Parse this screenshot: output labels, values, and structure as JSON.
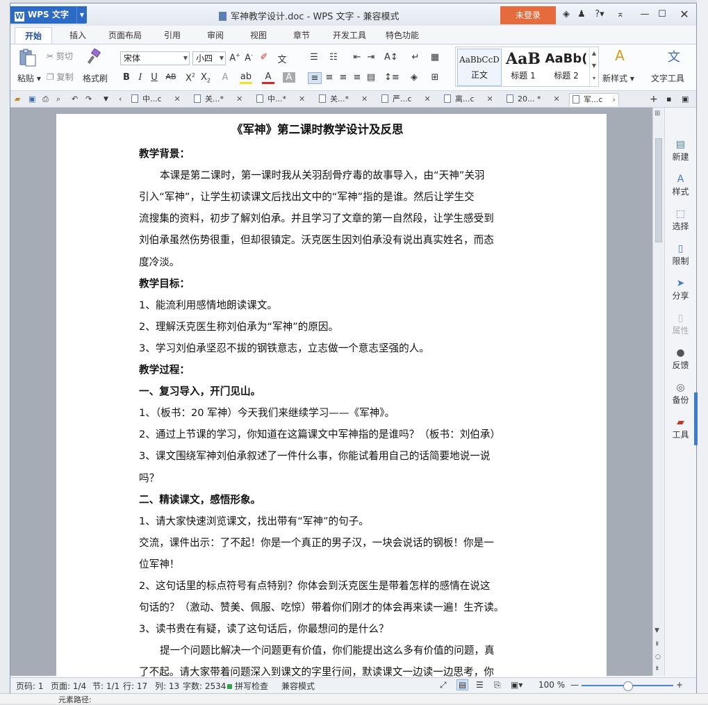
{
  "window": {
    "app_name": "WPS 文字",
    "title": "军神教学设计.doc - WPS 文字 - 兼容模式",
    "login_button": "未登录",
    "controls": [
      "help-?",
      "minimize",
      "maximize",
      "close"
    ]
  },
  "ribbon": {
    "tabs": [
      "开始",
      "插入",
      "页面布局",
      "引用",
      "审阅",
      "视图",
      "章节",
      "开发工具",
      "特色功能"
    ],
    "active_tab": "开始",
    "clipboard": {
      "paste": "粘贴",
      "cut": "剪切",
      "copy": "复制",
      "format_painter": "格式刷"
    },
    "font_name": "宋体",
    "font_size": "小四",
    "styles": [
      {
        "preview": "AaBbCcD",
        "label": "正文"
      },
      {
        "preview": "AaB",
        "label": "标题 1"
      },
      {
        "preview": "AaBb(",
        "label": "标题 2"
      }
    ],
    "new_style": "新样式",
    "text_tools": "文字工具"
  },
  "doc_tabs": [
    {
      "label": "中...c",
      "active": false
    },
    {
      "label": "关...*",
      "active": false
    },
    {
      "label": "中...*",
      "active": false
    },
    {
      "label": "关...*",
      "active": false
    },
    {
      "label": "严...c",
      "active": false
    },
    {
      "label": "离...c",
      "active": false
    },
    {
      "label": "20... *",
      "active": false
    },
    {
      "label": "军...c",
      "active": true
    }
  ],
  "sidebar": [
    {
      "label": "新建",
      "icon": "new-doc-icon"
    },
    {
      "label": "样式",
      "icon": "style-icon"
    },
    {
      "label": "选择",
      "icon": "select-icon"
    },
    {
      "label": "限制",
      "icon": "restrict-icon"
    },
    {
      "label": "分享",
      "icon": "share-icon"
    },
    {
      "label": "属性",
      "icon": "properties-icon"
    },
    {
      "label": "反馈",
      "icon": "feedback-icon"
    },
    {
      "label": "备份",
      "icon": "backup-icon"
    },
    {
      "label": "工具",
      "icon": "toolbox-icon"
    }
  ],
  "document": {
    "title": "《军神》第二课时教学设计及反思",
    "lines": [
      {
        "text": "教学背景：",
        "bold": true
      },
      {
        "text": "本课是第二课时，第一课时我从关羽刮骨疗毒的故事导入，由“天神”关羽",
        "indent": true
      },
      {
        "text": "引入“军神”，让学生初读课文后找出文中的“军神”指的是谁。然后让学生交"
      },
      {
        "text": "流搜集的资料，初步了解刘伯承。并且学习了文章的第一自然段，让学生感受到"
      },
      {
        "text": "刘伯承虽然伤势很重，但却很镇定。沃克医生因刘伯承没有说出真实姓名，而态"
      },
      {
        "text": "度冷淡。"
      },
      {
        "text": "教学目标：",
        "bold": true
      },
      {
        "text": "1、能流利用感情地朗读课文。"
      },
      {
        "text": "2、理解沃克医生称刘伯承为“军神”的原因。"
      },
      {
        "text": "3、学习刘伯承坚忍不拔的钢铁意志，立志做一个意志坚强的人。"
      },
      {
        "text": "教学过程：",
        "bold": true
      },
      {
        "text": "一、复习导入，开门见山。",
        "bold": true
      },
      {
        "text": "1、（板书：20 军神）今天我们来继续学习——《军神》。"
      },
      {
        "text": "2、通过上节课的学习，你知道在这篇课文中军神指的是谁吗？（板书：刘伯承）"
      },
      {
        "text": "3、课文围绕军神刘伯承叙述了一件什么事，你能试着用自己的话简要地说一说"
      },
      {
        "text": "吗？"
      },
      {
        "text": "二、精读课文，感悟形象。",
        "bold": true
      },
      {
        "text": "1、请大家快速浏览课文，找出带有“军神”的句子。"
      },
      {
        "text": "交流，课件出示：了不起！你是一个真正的男子汉，一块会说话的钢板！你是一"
      },
      {
        "text": "位军神！"
      },
      {
        "text": "2、这句话里的标点符号有点特别？你体会到沃克医生是带着怎样的感情在说这"
      },
      {
        "text": "句话的？（激动、赞美、佩服、吃惊）带着你们刚才的体会再来读一遍！生齐读。"
      },
      {
        "text": "3、读书贵在有疑，读了这句话后，你最想问的是什么？"
      },
      {
        "text": "提一个问题比解决一个问题更有价值，你们能提出这么多有价值的问题，真",
        "indent": true
      },
      {
        "text": "了不起。请大家带着问题深入到课文的字里行间，默读课文一边读一边思考，你"
      }
    ]
  },
  "status": {
    "page_no": "页码: 1",
    "pages": "页面: 1/4",
    "section": "节: 1/1",
    "row": "行: 17",
    "col": "列: 13",
    "words": "字数: 2534",
    "spell": "拼写检查",
    "compat": "兼容模式",
    "zoom": "100 %",
    "zoom_level": 0.5
  },
  "background": {
    "bottom_text": "元素路径:"
  }
}
